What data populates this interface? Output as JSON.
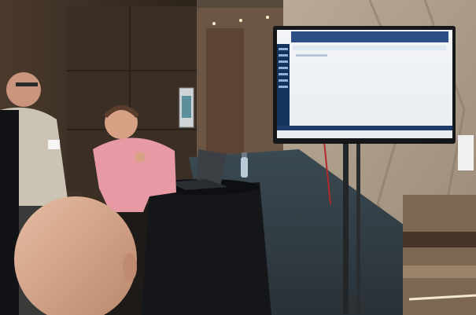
{
  "scene": {
    "description_icons": [
      "wall-panel",
      "tv-monitor",
      "laptop",
      "water-bottle",
      "speaker-person",
      "attendee",
      "bald-head"
    ]
  },
  "screen": {
    "window_title": "",
    "tab_label": ""
  }
}
